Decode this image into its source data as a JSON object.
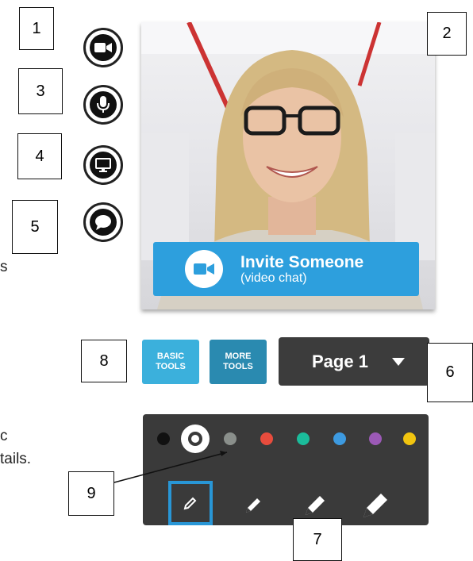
{
  "callouts": [
    "1",
    "2",
    "3",
    "4",
    "5",
    "6",
    "7",
    "8",
    "9"
  ],
  "stray_text": [
    "s",
    "c",
    "tails."
  ],
  "sidebar": {
    "items": [
      {
        "icon": "camera-icon"
      },
      {
        "icon": "microphone-icon"
      },
      {
        "icon": "screen-share-icon"
      },
      {
        "icon": "chat-icon"
      }
    ]
  },
  "video": {
    "invite_label": "Invite Someone",
    "invite_sublabel": "(video chat)"
  },
  "toolbar": {
    "basic_tools": [
      "BASIC",
      "TOOLS"
    ],
    "more_tools": [
      "MORE",
      "TOOLS"
    ],
    "page_label": "Page 1"
  },
  "palette": {
    "colors": [
      "#111111",
      "#ffffff",
      "#8a8f8b",
      "#e84c3d",
      "#1bbc9b",
      "#3d9ae0",
      "#9b59b6",
      "#f1c40f"
    ],
    "selected_color": "#ffffff",
    "pen_sizes": [
      "thin",
      "medium",
      "thick",
      "extra-thick"
    ],
    "selected_pen": "thin"
  },
  "colors": {
    "accent_blue": "#2d9fdd",
    "basic_tools_bg": "#3bb0dc",
    "more_tools_bg": "#2a8ab0",
    "dark_panel": "#3a3a3a"
  }
}
